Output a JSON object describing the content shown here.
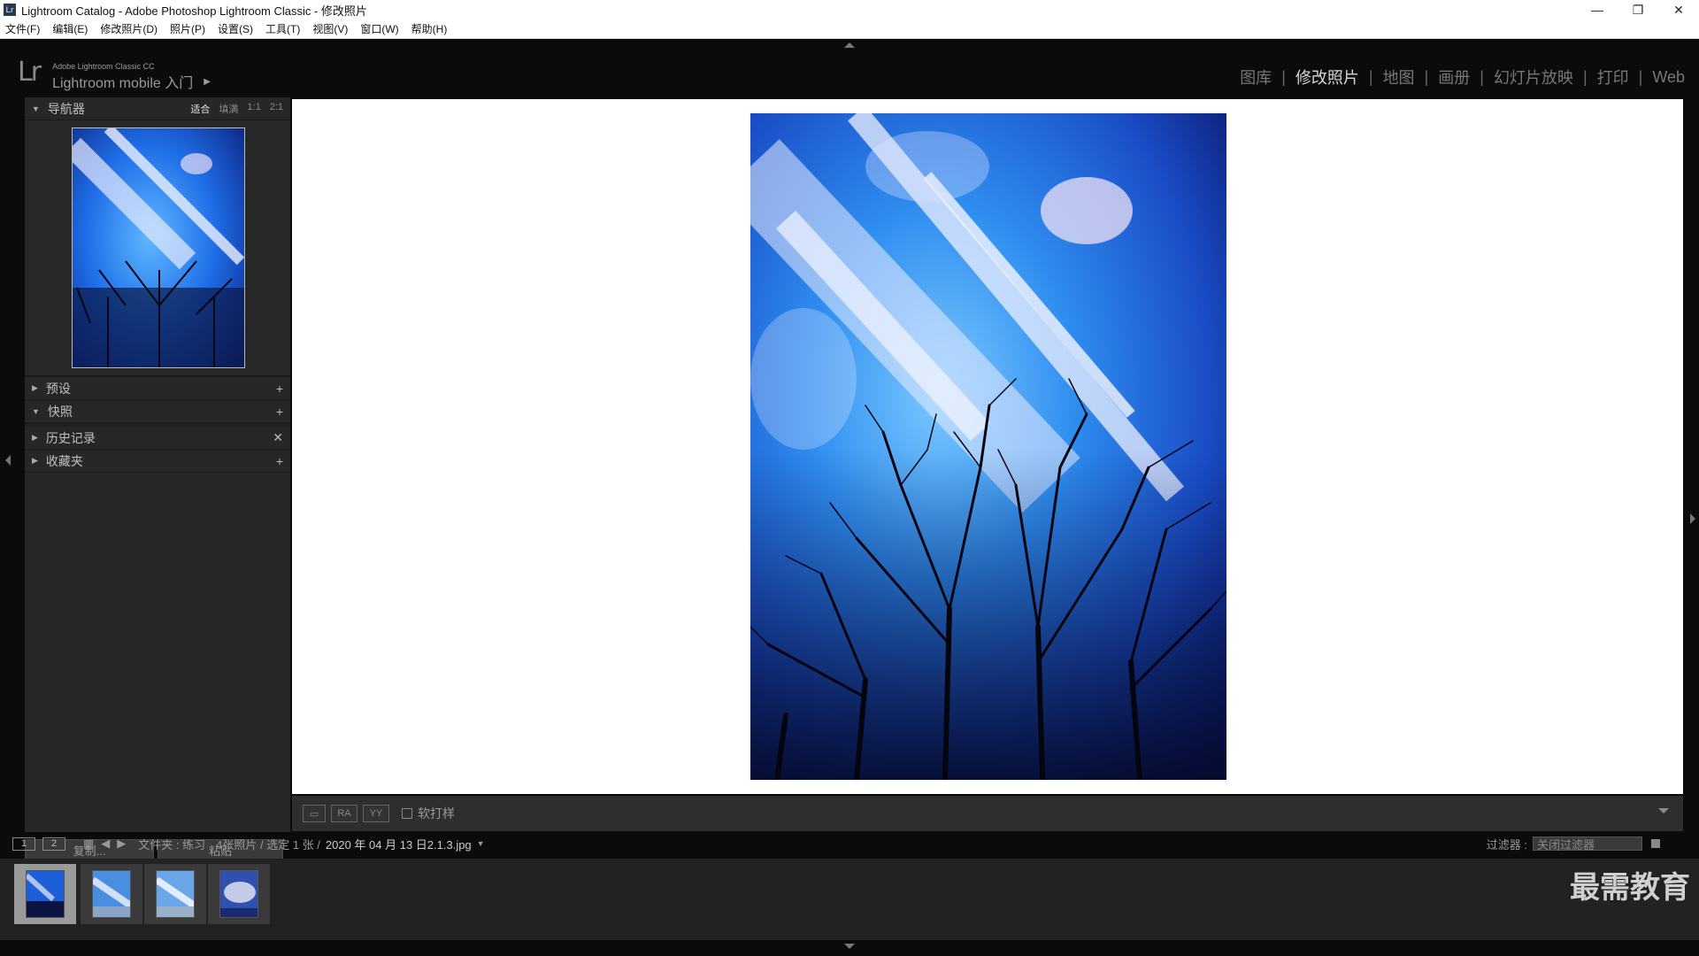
{
  "window": {
    "title": "Lightroom Catalog - Adobe Photoshop Lightroom Classic - 修改照片",
    "icon": "Lr",
    "minimize": "—",
    "restore": "❐",
    "close": "✕"
  },
  "menu": [
    "文件(F)",
    "编辑(E)",
    "修改照片(D)",
    "照片(P)",
    "设置(S)",
    "工具(T)",
    "视图(V)",
    "窗口(W)",
    "帮助(H)"
  ],
  "identity": {
    "logo": "Lr",
    "small": "Adobe Lightroom Classic CC",
    "main": "Lightroom mobile 入门"
  },
  "modules": [
    "图库",
    "修改照片",
    "地图",
    "画册",
    "幻灯片放映",
    "打印",
    "Web"
  ],
  "active_module": "修改照片",
  "navigator": {
    "title": "导航器",
    "opts": [
      "适合",
      "填满",
      "1:1",
      "2:1"
    ],
    "active_opt": "适合"
  },
  "panels": [
    {
      "title": "预设",
      "action": "+"
    },
    {
      "title": "快照",
      "action": "+"
    },
    {
      "title": "历史记录",
      "action": "✕"
    },
    {
      "title": "收藏夹",
      "action": "+"
    }
  ],
  "copy_label": "复制...",
  "paste_label": "粘贴",
  "toolbar": {
    "softproof_label": "软打样"
  },
  "filmbar": {
    "page1": "1",
    "page2": "2",
    "folder": "文件夹 : 练习",
    "count": "4张照片 / 选定 1 张 /",
    "file": "2020 年 04 月 13 日2.1.3.jpg",
    "filter_label": "过滤器 :",
    "filter_value": "关闭过滤器"
  },
  "watermark": "最需教育",
  "colors": {
    "sky_top": "#1a3fa8",
    "sky_mid": "#2f8ef0",
    "cloud": "#e8eaf8",
    "tree": "#0a0a18"
  }
}
